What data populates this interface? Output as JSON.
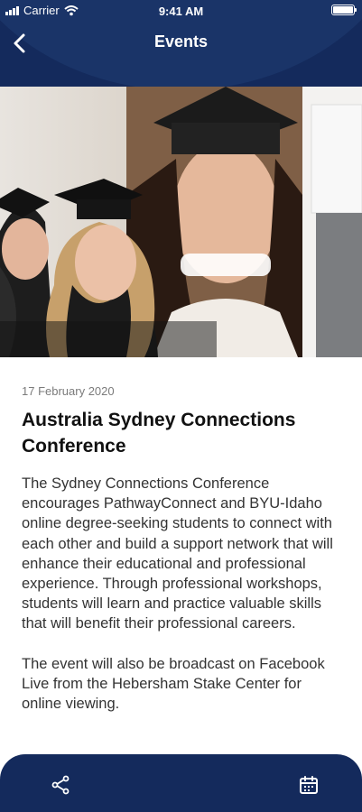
{
  "status_bar": {
    "carrier": "Carrier",
    "time": "9:41 AM"
  },
  "nav": {
    "title": "Events",
    "back_icon": "chevron-left-icon"
  },
  "event": {
    "date": "17 February 2020",
    "title": "Australia Sydney Connections Conference",
    "paragraphs": [
      "The Sydney Connections Conference encourages PathwayConnect and BYU-Idaho online degree-seeking students to connect with each other and build a support network that will enhance their educational and professional experience. Through professional workshops, students will learn and practice valuable skills that will benefit their professional careers.",
      "The event will also be broadcast on Facebook Live from the Hebersham Stake Center for online viewing."
    ]
  },
  "footer": {
    "share_icon": "share-icon",
    "calendar_icon": "calendar-icon"
  },
  "colors": {
    "header": "#142a5c",
    "header_arc": "#1a3468",
    "text": "#333333",
    "date": "#7b7b7b"
  }
}
